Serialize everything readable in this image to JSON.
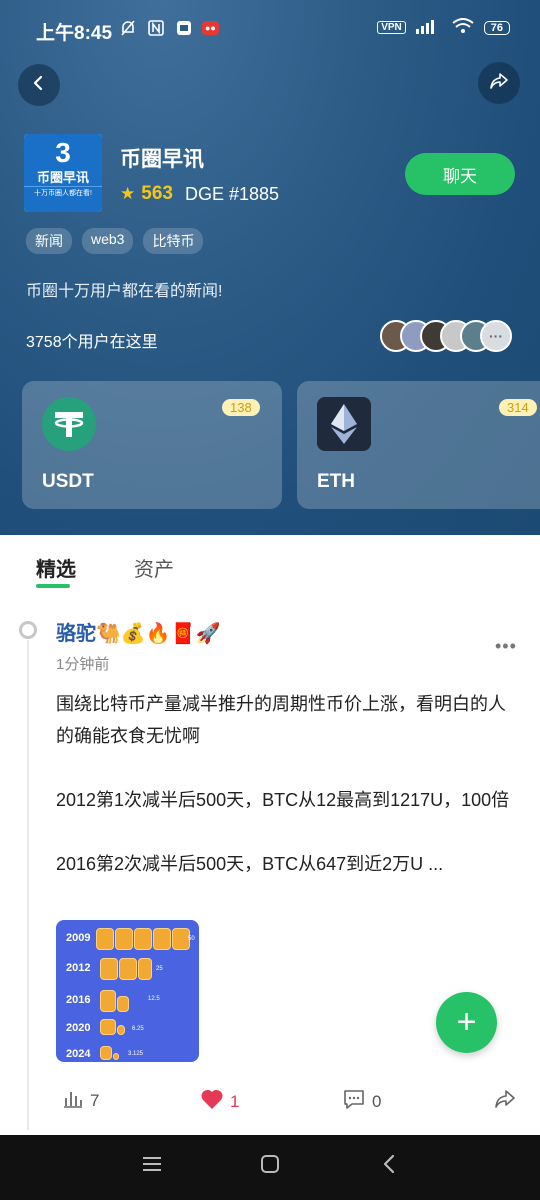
{
  "status": {
    "time": "上午8:45",
    "vpn": "VPN",
    "network": "HD",
    "battery": "76"
  },
  "header": {
    "logo_numeral": "3",
    "logo_name": "币圈早讯",
    "logo_slogan": "十万币圈人都在看!",
    "title": "币圈早讯",
    "score": "563",
    "dge": "DGE #1885",
    "chat_label": "聊天",
    "tags": [
      "新闻",
      "web3",
      "比特币"
    ],
    "description": "币圈十万用户都在看的新闻!",
    "users_count": "3758个用户在这里"
  },
  "tokens": [
    {
      "name": "USDT",
      "count": "138"
    },
    {
      "name": "ETH",
      "count": "314"
    }
  ],
  "tabs": [
    {
      "label": "精选",
      "active": true
    },
    {
      "label": "资产",
      "active": false
    }
  ],
  "post": {
    "author": "骆驼🐫💰🔥🧧🚀",
    "time": "1分钟前",
    "text": "围绕比特币产量减半推升的周期性币价上涨，看明白的人的确能衣食无忧啊\n\n2012第1次减半后500天，BTC从12最高到1217U，100倍\n\n2016第2次减半后500天，BTC从647到近2万U ...",
    "image": {
      "rows": [
        {
          "year": "2009",
          "amount": "50"
        },
        {
          "year": "2012",
          "amount": "25"
        },
        {
          "year": "2016",
          "amount": "12.5"
        },
        {
          "year": "2020",
          "amount": "6.25"
        },
        {
          "year": "2024",
          "amount": "3.125"
        }
      ]
    },
    "views": "7",
    "likes": "1",
    "comments": "0"
  },
  "colors": {
    "accent_green": "#27c267",
    "author_blue": "#2b5da7",
    "like_red": "#e53955",
    "score_gold": "#f5c518"
  }
}
